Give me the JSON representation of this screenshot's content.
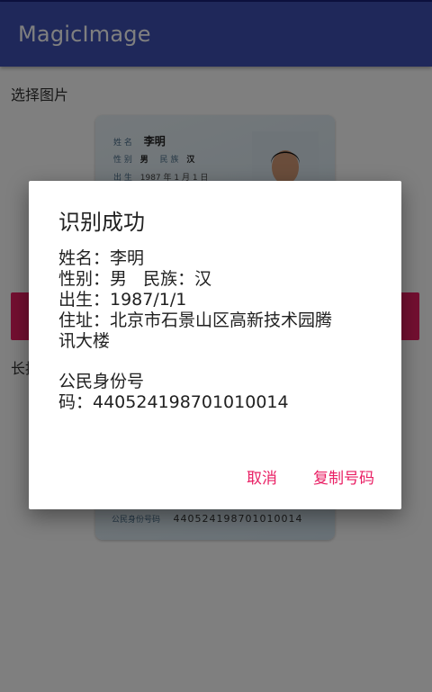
{
  "app_bar": {
    "title": "MagicImage"
  },
  "content": {
    "select_label": "选择图片",
    "long_label": "长按",
    "id_card": {
      "name_label": "姓 名",
      "name_value": "李明",
      "sex_label": "性 别",
      "sex_value": "男",
      "ethnicity_label": "民 族",
      "ethnicity_value": "汉",
      "birth_label": "出 生",
      "birth_value": "1987 年 1 月 1 日",
      "number_label": "公民身份号码",
      "number_value": "440524198701010014"
    }
  },
  "dialog": {
    "title": "识别成功",
    "lines": [
      "姓名：李明",
      "性别：男   民族：汉",
      "出生：1987/1/1",
      "住址：北京市石景山区高新技术园腾",
      "讯大楼",
      "",
      "公民身份号",
      "码：440524198701010014"
    ],
    "cancel_label": "取消",
    "copy_label": "复制号码"
  },
  "colors": {
    "primary": "#3f51b5",
    "accent": "#e91e63"
  }
}
